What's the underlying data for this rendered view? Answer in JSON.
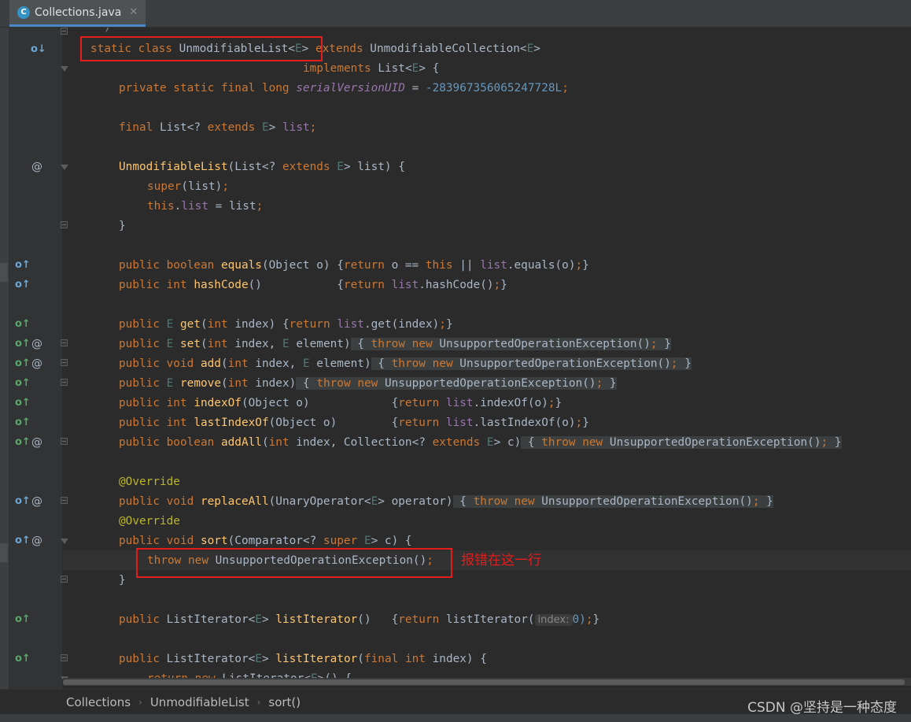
{
  "tab": {
    "icon_letter": "C",
    "title": "Collections.java",
    "close": "✕"
  },
  "annotation_text": "报错在这一行",
  "breadcrumb": [
    "Collections",
    "UnmodifiableList",
    "sort()"
  ],
  "watermark": "CSDN @坚持是一种态度",
  "hint": {
    "param": "index:"
  },
  "colors": {
    "keyword": "#cc7832",
    "function": "#ffc66d",
    "field": "#9876aa",
    "number": "#6897bb",
    "annotation": "#bbb529",
    "highlight_box": "#e41c1c",
    "background": "#2b2b2b"
  },
  "code": {
    "comment_end": "*/",
    "l1": {
      "static": "static",
      "class": "class",
      "name": "UnmodifiableList",
      "lt": "<",
      "e": "E",
      "gt": ">",
      "extends": "extends",
      "super": "UnmodifiableCollection",
      "e2": "E",
      "open": "<",
      "close": ">"
    },
    "l2": {
      "implements": "implements",
      "list": "List",
      "e": "E",
      "rest": "> {"
    },
    "l3": {
      "mods": "private static final long",
      "field": "serialVersionUID",
      "eq": " = ",
      "value": "-283967356065247728L",
      "semi": ";"
    },
    "l4": {
      "final": "final",
      "type": "List<? ",
      "extends": "extends",
      "e": "E",
      "gt": ">",
      "field": "list",
      "semi": ";"
    },
    "l5": {
      "name": "UnmodifiableList",
      "p1": "(List<? ",
      "extends": "extends",
      "e": "E",
      "p2": "> list) {"
    },
    "l6": {
      "super": "super",
      "rest": "(list)",
      "semi": ";"
    },
    "l7": {
      "this": "this",
      "dot": ".",
      "field": "list",
      "rest": " = list",
      "semi": ";"
    },
    "l8": "}",
    "l9": {
      "mods": "public boolean",
      "name": "equals",
      "p1": "(Object o) {",
      "ret": "return",
      "p2": " o == ",
      "this": "this",
      "p3": " || ",
      "field": "list",
      "p4": ".equals(o)",
      "semi": ";",
      "end": "}"
    },
    "l10": {
      "mods": "public int",
      "name": "hashCode",
      "p1": "()           {",
      "ret": "return",
      "sp": " ",
      "field": "list",
      "p2": ".hashCode()",
      "semi": ";",
      "end": "}"
    },
    "l11": {
      "mods": "public",
      "e": "E",
      "name": "get",
      "p1": "(",
      "int": "int",
      "p2": " index) {",
      "ret": "return",
      "sp": " ",
      "field": "list",
      "p3": ".get(index)",
      "semi": ";",
      "end": "}"
    },
    "l12": {
      "mods": "public",
      "e": "E",
      "name": "set",
      "p1": "(",
      "int": "int",
      "p2": " index, ",
      "e2": "E",
      "p3": " element)",
      "ob": " {",
      "throw": "throw",
      "new": "new",
      "ex": "UnsupportedOperationException()",
      "semi": ";",
      "cb": " }"
    },
    "l13": {
      "mods": "public void",
      "name": "add",
      "p1": "(",
      "int": "int",
      "p2": " index, ",
      "e2": "E",
      "p3": " element)",
      "ob": " {",
      "throw": "throw",
      "new": "new",
      "ex": "UnsupportedOperationException()",
      "semi": ";",
      "cb": " }"
    },
    "l14": {
      "mods": "public",
      "e": "E",
      "name": "remove",
      "p1": "(",
      "int": "int",
      "p2": " index)",
      "ob": " {",
      "throw": "throw",
      "new": "new",
      "ex": "UnsupportedOperationException()",
      "semi": ";",
      "cb": " }"
    },
    "l15": {
      "mods": "public int",
      "name": "indexOf",
      "p1": "(Object o)            {",
      "ret": "return",
      "sp": " ",
      "field": "list",
      "p2": ".indexOf(o)",
      "semi": ";",
      "end": "}"
    },
    "l16": {
      "mods": "public int",
      "name": "lastIndexOf",
      "p1": "(Object o)        {",
      "ret": "return",
      "sp": " ",
      "field": "list",
      "p2": ".lastIndexOf(o)",
      "semi": ";",
      "end": "}"
    },
    "l17": {
      "mods": "public boolean",
      "name": "addAll",
      "p1": "(",
      "int": "int",
      "p2": " index, Collection<? ",
      "extends": "extends",
      "e": "E",
      "p3": "> c)",
      "ob": " {",
      "throw": "throw",
      "new": "new",
      "ex": "UnsupportedOperationException()",
      "semi": ";",
      "cb": " }"
    },
    "l18": "@Override",
    "l19": {
      "mods": "public void",
      "name": "replaceAll",
      "p1": "(UnaryOperator<",
      "e": "E",
      "p2": "> operator)",
      "ob": " {",
      "throw": "throw",
      "new": "new",
      "ex": "UnsupportedOperationException()",
      "semi": ";",
      "cb": " }"
    },
    "l20": "@Override",
    "l21": {
      "mods": "public void",
      "name": "sort",
      "p1": "(Comparator<? ",
      "super": "super",
      "e": "E",
      "p2": "> c) {"
    },
    "l22": {
      "throw": "throw",
      "new": "new",
      "ex": "UnsupportedOperationException()",
      "semi": ";"
    },
    "l23": "}",
    "l24": {
      "mods": "public",
      "type": "ListIterator<",
      "e": "E",
      "gt": ">",
      "name": "listIterator",
      "p1": "()   {",
      "ret": "return",
      "p2": " listIterator(",
      "p3": "0)",
      "semi": ";",
      "end": "}"
    },
    "l25": {
      "mods": "public",
      "type": "ListIterator<",
      "e": "E",
      "gt": ">",
      "name": "listIterator",
      "p1": "(",
      "final": "final",
      "int": "int",
      "p2": " index) {"
    },
    "l26": {
      "ret": "return",
      "new": "new",
      "type": "ListIterator<",
      "e": "E",
      "p2": ">() {"
    }
  }
}
